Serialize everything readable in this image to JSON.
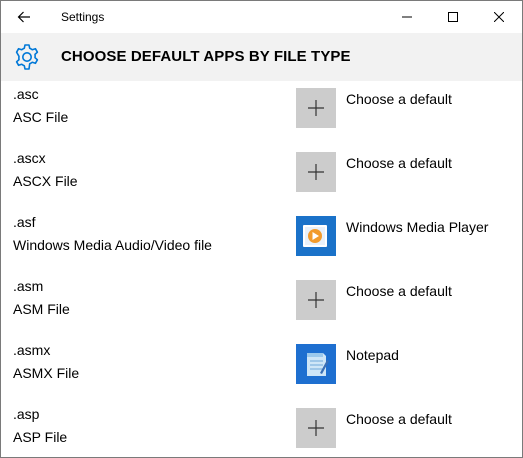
{
  "window": {
    "title": "Settings"
  },
  "header": {
    "title": "CHOOSE DEFAULT APPS BY FILE TYPE"
  },
  "file_types": [
    {
      "ext": ".asc",
      "description": "ASC File",
      "app": "Choose a default",
      "icon": "plus-icon"
    },
    {
      "ext": ".ascx",
      "description": "ASCX File",
      "app": "Choose a default",
      "icon": "plus-icon"
    },
    {
      "ext": ".asf",
      "description": "Windows Media Audio/Video file",
      "app": "Windows Media Player",
      "icon": "windows-media-player-icon"
    },
    {
      "ext": ".asm",
      "description": "ASM File",
      "app": "Choose a default",
      "icon": "plus-icon"
    },
    {
      "ext": ".asmx",
      "description": "ASMX File",
      "app": "Notepad",
      "icon": "notepad-icon"
    },
    {
      "ext": ".asp",
      "description": "ASP File",
      "app": "Choose a default",
      "icon": "plus-icon"
    }
  ],
  "colors": {
    "header_bg": "#f2f2f2",
    "accent": "#0078d7",
    "tile_gray": "#cccccc"
  }
}
